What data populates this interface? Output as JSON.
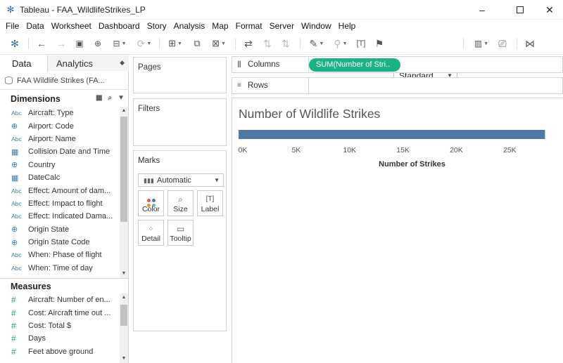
{
  "window": {
    "title": "Tableau - FAA_WildlifeStrikes_LP",
    "minimize": "–",
    "close": "✕"
  },
  "menu": [
    "File",
    "Data",
    "Worksheet",
    "Dashboard",
    "Story",
    "Analysis",
    "Map",
    "Format",
    "Server",
    "Window",
    "Help"
  ],
  "toolbar": {
    "fit_mode": "Standard"
  },
  "data_pane": {
    "tab_data": "Data",
    "tab_analytics": "Analytics",
    "datasource": "FAA Wildlife Strikes (FA...",
    "dimensions_header": "Dimensions",
    "dimensions": [
      {
        "icon": "Abc",
        "label": "Aircraft: Type"
      },
      {
        "icon": "globe",
        "label": "Airport: Code"
      },
      {
        "icon": "Abc",
        "label": "Airport: Name"
      },
      {
        "icon": "calendar",
        "label": "Collision Date and Time"
      },
      {
        "icon": "globe",
        "label": "Country"
      },
      {
        "icon": "calendar",
        "label": "DateCalc"
      },
      {
        "icon": "Abc",
        "label": "Effect: Amount of dam..."
      },
      {
        "icon": "Abc",
        "label": "Effect: Impact to flight"
      },
      {
        "icon": "Abc",
        "label": "Effect: Indicated Dama..."
      },
      {
        "icon": "globe",
        "label": "Origin State"
      },
      {
        "icon": "globe",
        "label": "Origin State Code"
      },
      {
        "icon": "Abc",
        "label": "When: Phase of flight"
      },
      {
        "icon": "Abc",
        "label": "When: Time of day"
      }
    ],
    "measures_header": "Measures",
    "measures": [
      {
        "icon": "#",
        "label": "Aircraft: Number of en..."
      },
      {
        "icon": "#",
        "label": "Cost: Aircraft time out ..."
      },
      {
        "icon": "#",
        "label": "Cost: Total $"
      },
      {
        "icon": "#",
        "label": "Days"
      },
      {
        "icon": "#",
        "label": "Feet above ground"
      }
    ]
  },
  "cards": {
    "pages": "Pages",
    "filters": "Filters",
    "marks": "Marks",
    "mark_type": "Automatic",
    "buttons": {
      "color": "Color",
      "size": "Size",
      "label": "Label",
      "detail": "Detail",
      "tooltip": "Tooltip"
    }
  },
  "shelves": {
    "columns": "Columns",
    "rows": "Rows",
    "columns_pill": "SUM(Number of Stri.."
  },
  "view": {
    "title": "Number of Wildlife Strikes"
  },
  "chart_data": {
    "type": "bar",
    "categories": [
      ""
    ],
    "values": [
      28300
    ],
    "title": "Number of Wildlife Strikes",
    "xlabel": "Number of Strikes",
    "ylabel": "",
    "xlim": [
      0,
      29000
    ],
    "ticks": [
      0,
      5000,
      10000,
      15000,
      20000,
      25000
    ],
    "tick_labels": [
      "0K",
      "5K",
      "10K",
      "15K",
      "20K",
      "25K"
    ],
    "orientation": "horizontal",
    "color": "#4e79a7"
  }
}
